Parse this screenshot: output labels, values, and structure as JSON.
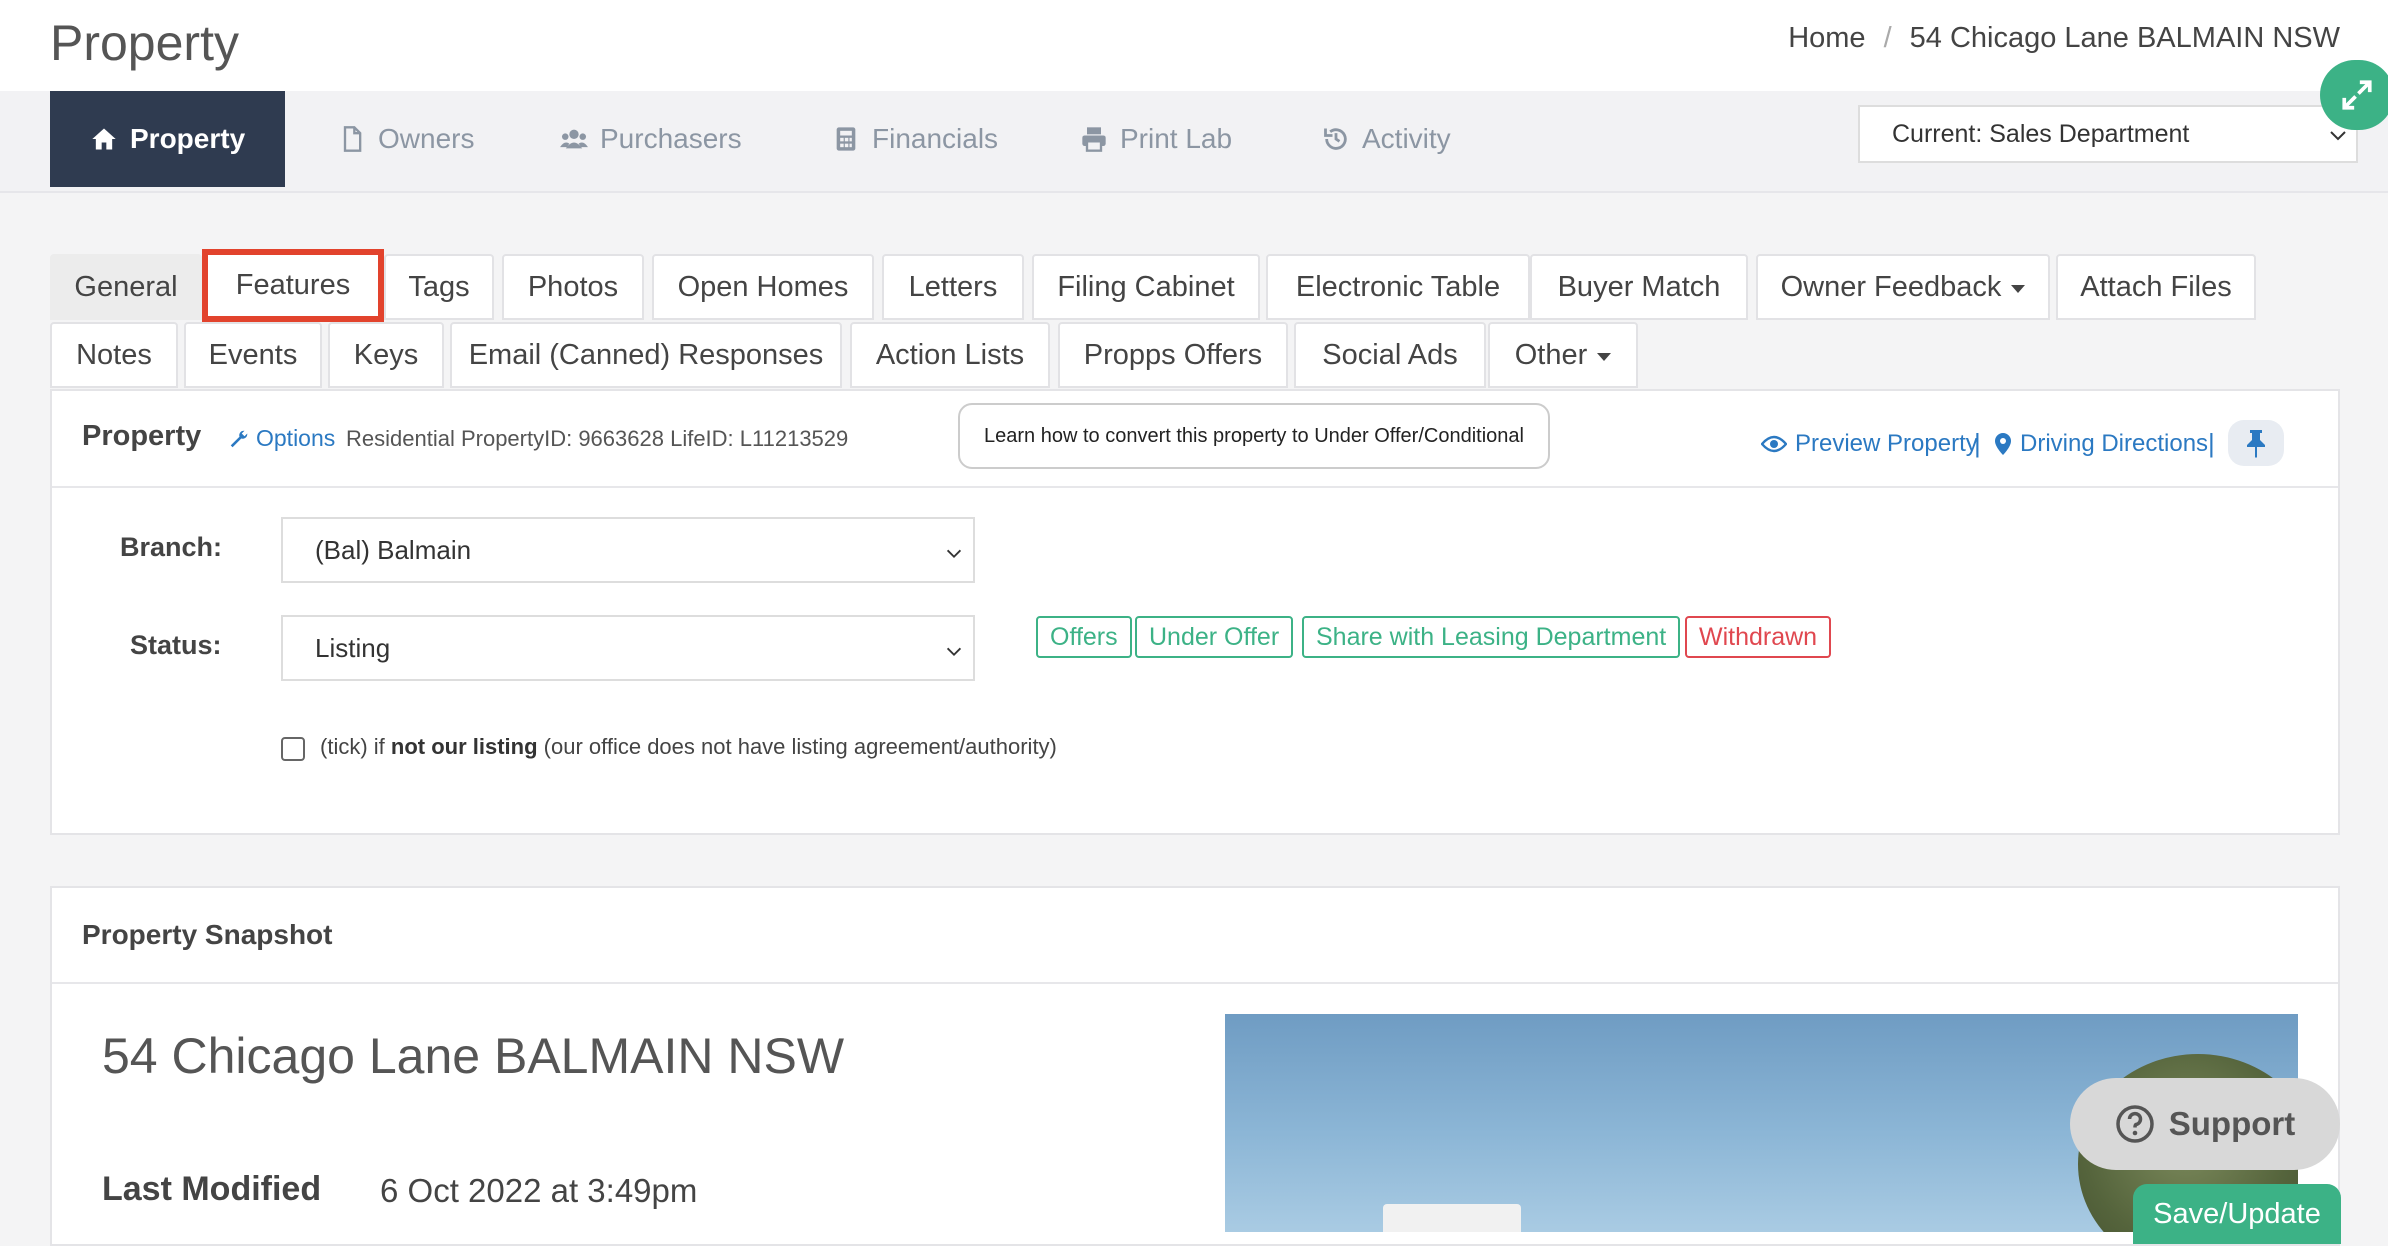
{
  "header": {
    "title": "Property",
    "breadcrumb": [
      "Home",
      "/",
      "54 Chicago Lane BALMAIN NSW"
    ]
  },
  "main_nav": {
    "items": [
      {
        "label": "Property",
        "icon": "home-icon",
        "active": true
      },
      {
        "label": "Owners",
        "icon": "file-icon"
      },
      {
        "label": "Purchasers",
        "icon": "users-icon"
      },
      {
        "label": "Financials",
        "icon": "calculator-icon"
      },
      {
        "label": "Print Lab",
        "icon": "printer-icon"
      },
      {
        "label": "Activity",
        "icon": "history-icon"
      }
    ],
    "department_select": "Current: Sales Department"
  },
  "tabs": {
    "row1": [
      "General",
      "Features",
      "Tags",
      "Photos",
      "Open Homes",
      "Letters",
      "Filing Cabinet",
      "Electronic Table",
      "Buyer Match",
      "Owner Feedback",
      "Attach Files"
    ],
    "row2": [
      "Notes",
      "Events",
      "Keys",
      "Email (Canned) Responses",
      "Action Lists",
      "Propps Offers",
      "Social Ads",
      "Other"
    ]
  },
  "property_panel": {
    "title": "Property",
    "options_label": "Options",
    "meta": "Residential PropertyID: 9663628  LifeID: L11213529",
    "tooltip": "Learn how to convert this property to Under Offer/Conditional",
    "preview_label": "Preview Property",
    "directions_label": "Driving Directions",
    "pipe": "|",
    "branch_label": "Branch:",
    "branch_value": "(Bal) Balmain",
    "status_label": "Status:",
    "status_value": "Listing",
    "status_actions": [
      "Offers",
      "Under Offer",
      "Share with Leasing Department",
      "Withdrawn"
    ],
    "checkbox_pre": "(tick) if ",
    "checkbox_bold": "not our listing",
    "checkbox_post": " (our office does not have listing agreement/authority)"
  },
  "snapshot": {
    "title": "Property Snapshot",
    "address": "54 Chicago Lane BALMAIN NSW",
    "last_modified_label": "Last Modified",
    "last_modified_value": "6 Oct 2022 at 3:49pm"
  },
  "support_label": "Support",
  "save_label": "Save/Update",
  "colors": {
    "accent_green": "#3cb286",
    "nav_dark": "#2f3b50",
    "link_blue": "#2b79c2",
    "danger_red": "#e0474f",
    "highlight_red": "#e2432d"
  }
}
